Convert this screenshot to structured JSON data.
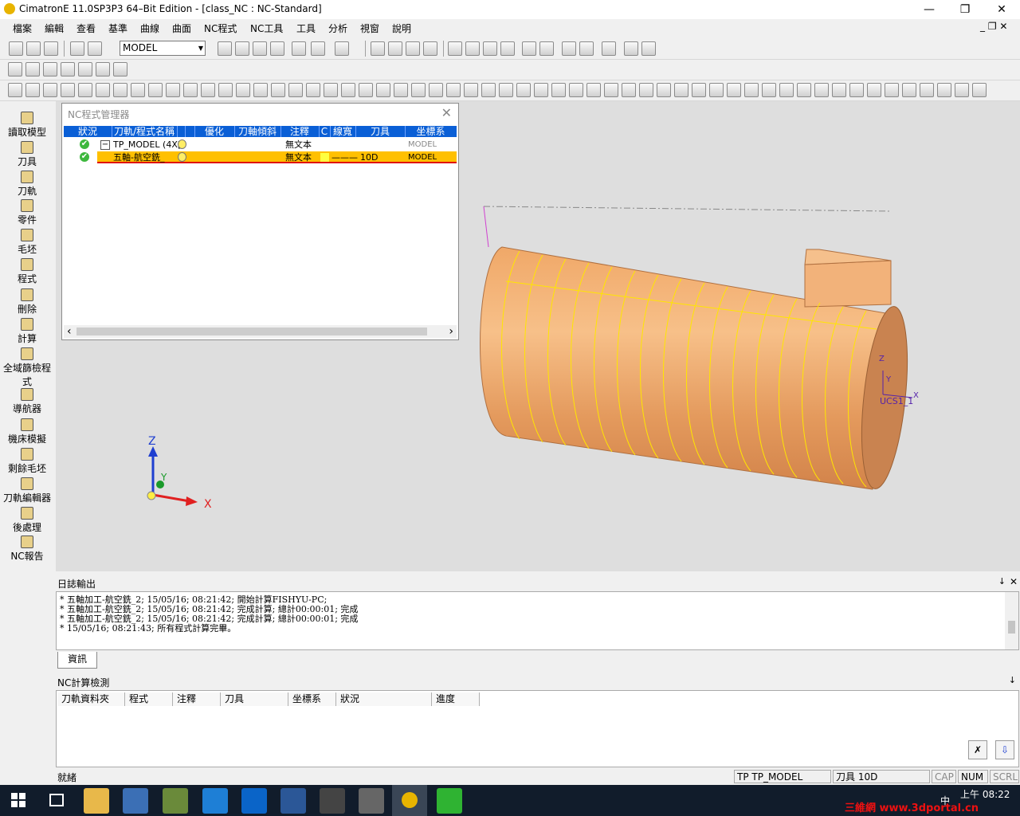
{
  "window": {
    "title": "CimatronE 11.0SP3P3 64–Bit Edition - [class_NC : NC-Standard]",
    "minimize": "—",
    "restore": "❐",
    "close": "✕",
    "mdi_controls": "_ ❐ ✕"
  },
  "menu": [
    "檔案",
    "編輯",
    "查看",
    "基準",
    "曲線",
    "曲面",
    "NC程式",
    "NC工具",
    "工具",
    "分析",
    "視窗",
    "說明"
  ],
  "toolbar": {
    "model_combo": "MODEL"
  },
  "left_panel": [
    {
      "label": "讀取模型"
    },
    {
      "label": "刀具"
    },
    {
      "label": "刀軌"
    },
    {
      "label": "零件"
    },
    {
      "label": "毛坯"
    },
    {
      "label": "程式"
    },
    {
      "label": "刪除"
    },
    {
      "label": "計算"
    },
    {
      "label": "全域篩檢程式"
    },
    {
      "label": "導航器"
    },
    {
      "label": "機床模擬"
    },
    {
      "label": "剩餘毛坯"
    },
    {
      "label": "刀軌編輯器"
    },
    {
      "label": "後處理"
    },
    {
      "label": "NC報告"
    }
  ],
  "nc_manager": {
    "title": "NC程式管理器",
    "close": "✕",
    "columns": [
      "狀況",
      "刀軌/程式名稱",
      "",
      "",
      "優化",
      "刀軸傾斜",
      "注釋",
      "C",
      "線寬",
      "刀具",
      "坐標系"
    ],
    "rows": [
      {
        "name": "TP_MODEL (4X[",
        "note": "無文本",
        "tool": "",
        "ucs": "MODEL",
        "expander": "−"
      },
      {
        "name": "五軸-航空銑_",
        "note": "無文本",
        "tool": "10D",
        "ucs": "MODEL",
        "line": "———"
      }
    ],
    "scroll_left": "‹",
    "scroll_right": "›"
  },
  "viewport": {
    "axis_z": "Z",
    "axis_y": "Y",
    "axis_x": "X",
    "ucs_label": "UCS1_1",
    "ucs_z": "Z",
    "ucs_y": "Y",
    "ucs_x": "X"
  },
  "log": {
    "title": "日誌輸出",
    "pin": "↓",
    "close": "✕",
    "lines": [
      "* 五軸加工-航空銑_2; 15/05/16; 08:21:42; 開始計算FISHYU-PC;",
      "* 五軸加工-航空銑_2; 15/05/16; 08:21:42; 完成計算; 總計00:00:01; 完成",
      "* 五軸加工-航空銑_2; 15/05/16; 08:21:42; 完成計算; 總計00:00:01; 完成",
      "* 15/05/16; 08:21:43; 所有程式計算完畢。"
    ],
    "tab": "資訊"
  },
  "nc_check": {
    "title": "NC計算檢測",
    "pin": "↓",
    "columns": [
      "刀軌資料夾",
      "程式",
      "注釋",
      "刀具",
      "坐標系",
      "狀況",
      "進度"
    ]
  },
  "status": {
    "ready": "就緒",
    "tp": "TP  TP_MODEL",
    "tool": "刀具  10D",
    "cap": "CAP",
    "num": "NUM",
    "scrl": "SCRL"
  },
  "taskbar": {
    "time": "上午 08:22",
    "ime": "中",
    "watermark": "三維網 www.3dportal.cn"
  },
  "colors": {
    "part": "#e7a46a",
    "selected_row": "#ffc000",
    "header_blue": "#0a5fd6",
    "taskbar": "#111c2b"
  }
}
